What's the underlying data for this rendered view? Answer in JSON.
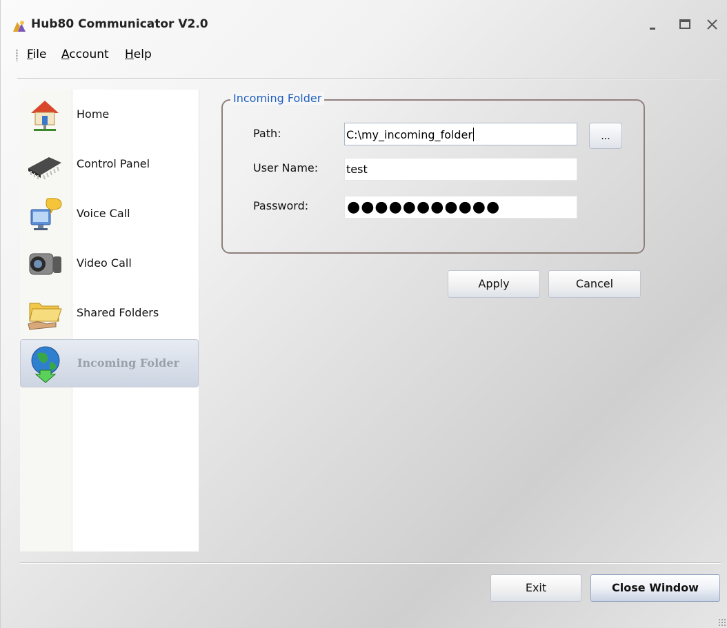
{
  "window": {
    "title": "Hub80 Communicator V2.0"
  },
  "menu": {
    "file": {
      "label": "File",
      "accel": "F",
      "rest": "ile"
    },
    "account": {
      "label": "Account",
      "accel": "A",
      "rest": "ccount"
    },
    "help": {
      "label": "Help",
      "accel": "H",
      "rest": "elp"
    }
  },
  "sidebar": {
    "items": [
      {
        "label": "Home",
        "icon": "home-icon"
      },
      {
        "label": "Control Panel",
        "icon": "chip-icon"
      },
      {
        "label": "Voice Call",
        "icon": "computer-chat-icon"
      },
      {
        "label": "Video Call",
        "icon": "camcorder-icon"
      },
      {
        "label": "Shared Folders",
        "icon": "shared-folder-icon"
      },
      {
        "label": "Incoming Folder",
        "icon": "globe-download-icon",
        "active": true
      }
    ]
  },
  "incoming": {
    "group_title": "Incoming Folder",
    "path_label": "Path:",
    "path_value": "C:\\my_incoming_folder",
    "browse_label": "...",
    "username_label": "User Name:",
    "username_value": "test",
    "password_label": "Password:",
    "password_mask": "●●●●●●●●●●●"
  },
  "actions": {
    "apply": "Apply",
    "cancel": "Cancel"
  },
  "footer": {
    "exit": "Exit",
    "close_window": "Close Window"
  },
  "colors": {
    "accent_blue": "#1f5fc0",
    "group_border": "#8f7f7c"
  }
}
